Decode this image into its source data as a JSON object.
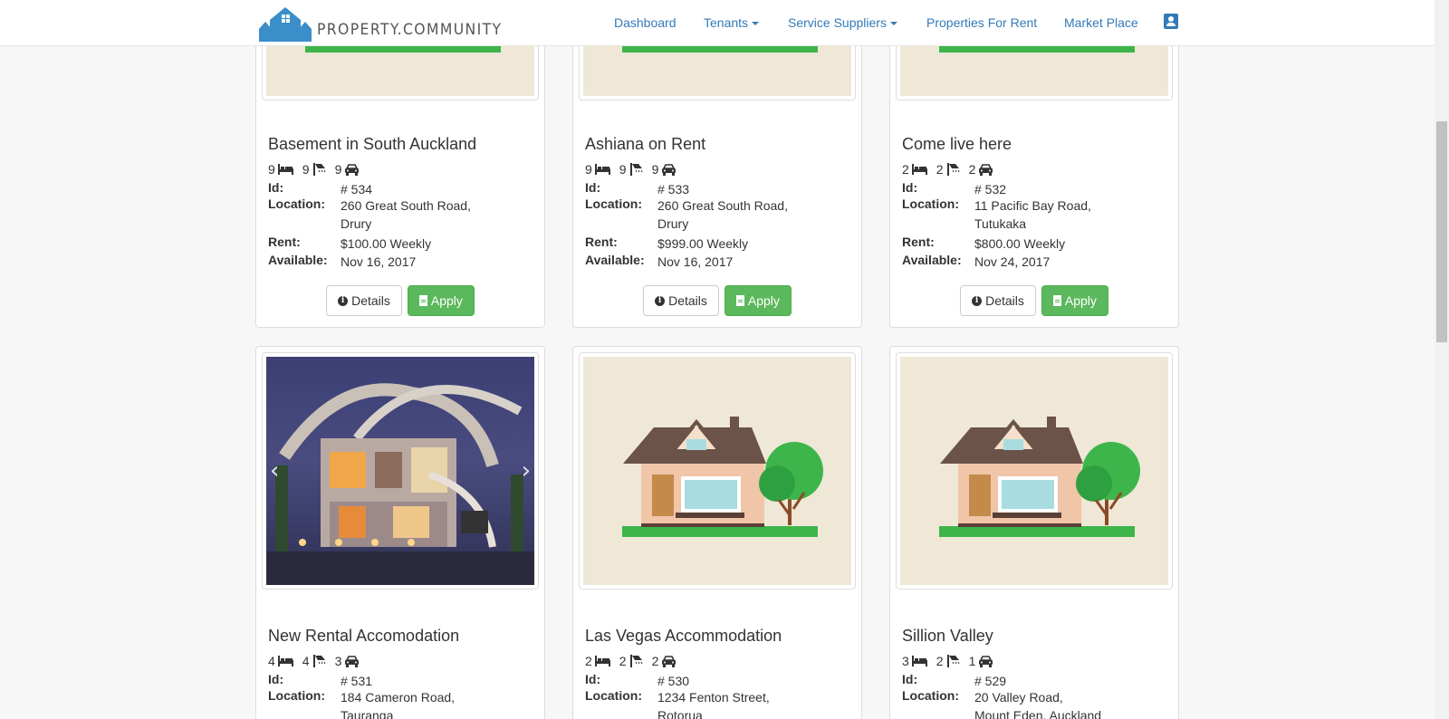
{
  "brand": {
    "name": "PROPERTY.COMMUNITY",
    "logo_icon": "houses-logo-icon"
  },
  "nav": {
    "dashboard": "Dashboard",
    "tenants": "Tenants",
    "service_suppliers": "Service Suppliers",
    "properties_for_rent": "Properties For Rent",
    "market_place": "Market Place",
    "user_icon": "user-account-icon"
  },
  "labels": {
    "id": "Id:",
    "location": "Location:",
    "rent": "Rent:",
    "available": "Available:",
    "details": "Details",
    "apply": "Apply"
  },
  "properties": [
    {
      "title": "Basement in South Auckland",
      "beds": "9",
      "baths": "9",
      "parking": "9",
      "id": "# 534",
      "location_1": "260 Great South Road,",
      "location_2": "Drury",
      "rent": "$100.00 Weekly",
      "available": "Nov 16, 2017"
    },
    {
      "title": "Ashiana on Rent",
      "beds": "9",
      "baths": "9",
      "parking": "9",
      "id": "# 533",
      "location_1": "260 Great South Road,",
      "location_2": "Drury",
      "rent": "$999.00 Weekly",
      "available": "Nov 16, 2017"
    },
    {
      "title": "Come live here",
      "beds": "2",
      "baths": "2",
      "parking": "2",
      "id": "# 532",
      "location_1": "11 Pacific Bay Road,",
      "location_2": "Tutukaka",
      "rent": "$800.00 Weekly",
      "available": "Nov 24, 2017"
    },
    {
      "title": "New Rental Accomodation",
      "beds": "4",
      "baths": "4",
      "parking": "3",
      "id": "# 531",
      "location_1": "184 Cameron Road,",
      "location_2": "Tauranga"
    },
    {
      "title": "Las Vegas Accommodation",
      "beds": "2",
      "baths": "2",
      "parking": "2",
      "id": "# 530",
      "location_1": "1234 Fenton Street,",
      "location_2": "Rotorua"
    },
    {
      "title": "Sillion Valley",
      "beds": "3",
      "baths": "2",
      "parking": "1",
      "id": "# 529",
      "location_1": "20 Valley Road,",
      "location_2": "Mount Eden, Auckland"
    }
  ],
  "colors": {
    "link": "#337ab7",
    "success": "#5cb85c",
    "placeholder_bg": "#efe8d6",
    "lawn_green": "#3db54a"
  }
}
